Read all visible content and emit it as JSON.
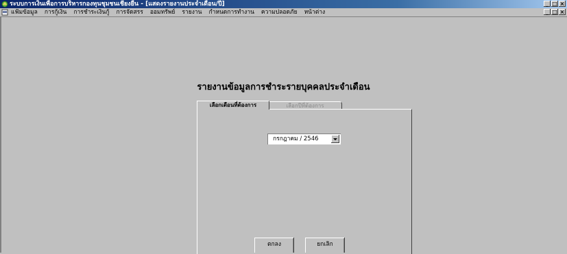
{
  "window": {
    "title": "ระบบการเงินเพื่อการบริหารกองทุนชุมชนเชียงยืน - [แสดงรายงานประจำเดือน/ปี]",
    "controls": [
      "_",
      "□",
      "×"
    ]
  },
  "menubar": {
    "items": [
      "แฟ้มข้อมูล",
      "การกู้เงิน",
      "การชำระเงินกู้",
      "การจัดสรร",
      "ออมทรัพย์",
      "รายงาน",
      "กำหนดการทำงาน",
      "ความปลอดภัย",
      "หน้าต่าง"
    ],
    "controls": [
      "_",
      "□",
      "×"
    ]
  },
  "report": {
    "title": "รายงานข้อมูลการชำระรายบุคคลประจำเดือน"
  },
  "tabs": {
    "active": "เลือกเดือนที่ต้องการ",
    "inactive": "เลือกปีที่ต้องการ"
  },
  "month_select": {
    "value": "กรกฎาคม / 2546"
  },
  "buttons": {
    "ok": "ตกลง",
    "cancel": "ยกเลิก"
  },
  "colors": {
    "titlebar": "#0a246a",
    "background": "#c0c0c0"
  }
}
